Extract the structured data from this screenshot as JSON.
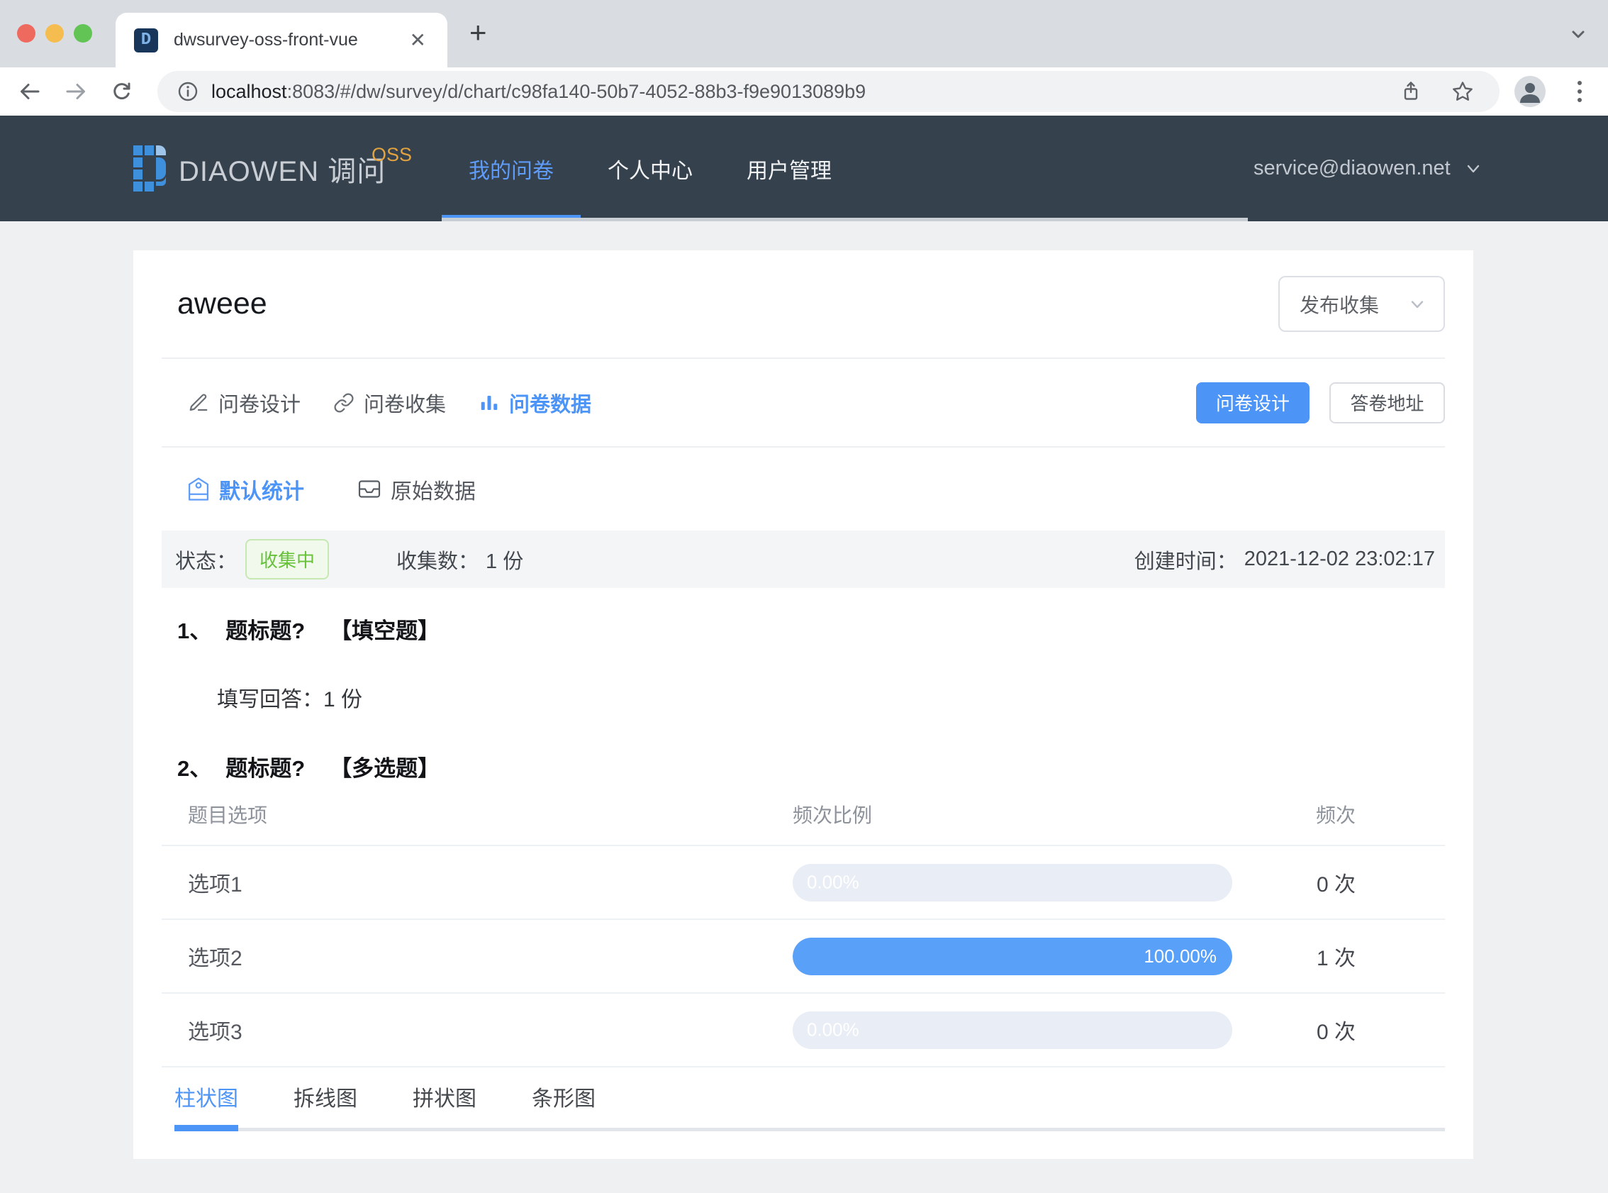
{
  "colors": {
    "accent": "#4D94F7",
    "bar_fill": "#59A0F8",
    "bar_track": "#E9EDF5",
    "header_bg": "#36414E",
    "success_text": "#67C23A",
    "success_bg": "#F0F9EB",
    "success_border": "#C6E8B3",
    "brand_badge_orange": "#E2A33F",
    "traffic_close": "#EE6A5F",
    "traffic_minimize": "#F5BD4F",
    "traffic_zoom": "#61C454"
  },
  "icons": {
    "tab_close_glyph": "✕",
    "new_tab_glyph": "+",
    "favicon_glyph": "D"
  },
  "browser": {
    "tab_title": "dwsurvey-oss-front-vue",
    "url_host": "localhost",
    "url_rest": ":8083/#/dw/survey/d/chart/c98fa140-50b7-4052-88b3-f9e9013089b9"
  },
  "header": {
    "brand_text": "DIAOWEN 调问",
    "brand_badge": "OSS",
    "nav_items": [
      {
        "label": "我的问卷",
        "active": true
      },
      {
        "label": "个人中心",
        "active": false
      },
      {
        "label": "用户管理",
        "active": false
      }
    ],
    "account_email": "service@diaowen.net"
  },
  "survey": {
    "title": "aweee",
    "publish_select_value": "发布收集",
    "main_tabs": [
      {
        "label": "问卷设计",
        "icon": "edit-icon",
        "active": false
      },
      {
        "label": "问卷收集",
        "icon": "link-icon",
        "active": false
      },
      {
        "label": "问卷数据",
        "icon": "bar-chart-icon",
        "active": true
      }
    ],
    "design_button": "问卷设计",
    "answer_url_button": "答卷地址",
    "stat_tabs": [
      {
        "label": "默认统计",
        "icon": "tag-icon",
        "active": true
      },
      {
        "label": "原始数据",
        "icon": "inbox-icon",
        "active": false
      }
    ],
    "status_bar": {
      "status_label": "状态：",
      "status_badge": "收集中",
      "count_label": "收集数：",
      "count_value": "1 份",
      "created_label": "创建时间：",
      "created_value": "2021-12-02 23:02:17"
    }
  },
  "questions": {
    "q1": {
      "number": "1、",
      "title": "题标题?",
      "type_tag": "【填空题】",
      "answer_label": "填写回答：",
      "answer_value": "1 份"
    },
    "q2": {
      "number": "2、",
      "title": "题标题?",
      "type_tag": "【多选题】",
      "columns": {
        "option": "题目选项",
        "ratio": "频次比例",
        "freq": "频次"
      },
      "rows": [
        {
          "option": "选项1",
          "percent_label": "0.00%",
          "percent": 0,
          "freq": "0 次"
        },
        {
          "option": "选项2",
          "percent_label": "100.00%",
          "percent": 100,
          "freq": "1 次"
        },
        {
          "option": "选项3",
          "percent_label": "0.00%",
          "percent": 0,
          "freq": "0 次"
        }
      ]
    }
  },
  "chart_tabs": [
    {
      "label": "柱状图",
      "active": true
    },
    {
      "label": "拆线图",
      "active": false
    },
    {
      "label": "拼状图",
      "active": false
    },
    {
      "label": "条形图",
      "active": false
    }
  ]
}
